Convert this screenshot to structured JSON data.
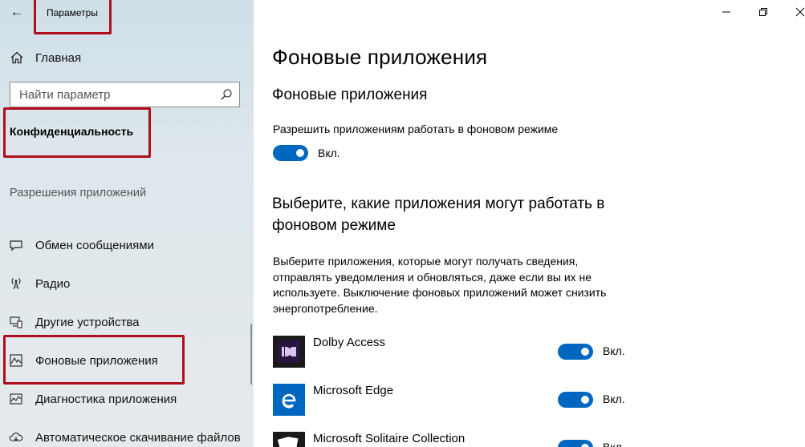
{
  "window": {
    "title": "Параметры"
  },
  "sidebar": {
    "home_label": "Главная",
    "search_placeholder": "Найти параметр",
    "section_title": "Конфиденциальность",
    "group_title": "Разрешения приложений",
    "items": [
      {
        "label": "Обмен сообщениями",
        "icon": "message-icon"
      },
      {
        "label": "Радио",
        "icon": "radio-icon"
      },
      {
        "label": "Другие устройства",
        "icon": "devices-icon"
      },
      {
        "label": "Фоновые приложения",
        "icon": "background-apps-icon"
      },
      {
        "label": "Диагностика приложения",
        "icon": "diagnostics-icon"
      },
      {
        "label": "Автоматическое скачивание файлов",
        "icon": "cloud-download-icon"
      }
    ]
  },
  "main": {
    "title": "Фоновые приложения",
    "section1_title": "Фоновые приложения",
    "allow_label": "Разрешить приложениям работать в фоновом режиме",
    "allow_state": "Вкл.",
    "section2_title_line1": "Выберите, какие приложения могут работать в",
    "section2_title_line2": "фоновом режиме",
    "description_lines": [
      "Выберите приложения, которые могут получать сведения,",
      "отправлять уведомления и обновляться, даже если вы их не",
      "используете. Выключение фоновых приложений может снизить",
      "энергопотребление."
    ],
    "apps": [
      {
        "name": "Dolby Access",
        "state": "Вкл.",
        "tile_color": "#1a1a1a"
      },
      {
        "name": "Microsoft Edge",
        "state": "Вкл.",
        "tile_color": "#0067c0"
      },
      {
        "name": "Microsoft Solitaire Collection",
        "state": "Вкл.",
        "tile_color": "#1a1a1a"
      }
    ]
  },
  "colors": {
    "accent": "#0067c0",
    "highlight": "#b00d1d",
    "sidebar_bg": "#dde7ec"
  }
}
